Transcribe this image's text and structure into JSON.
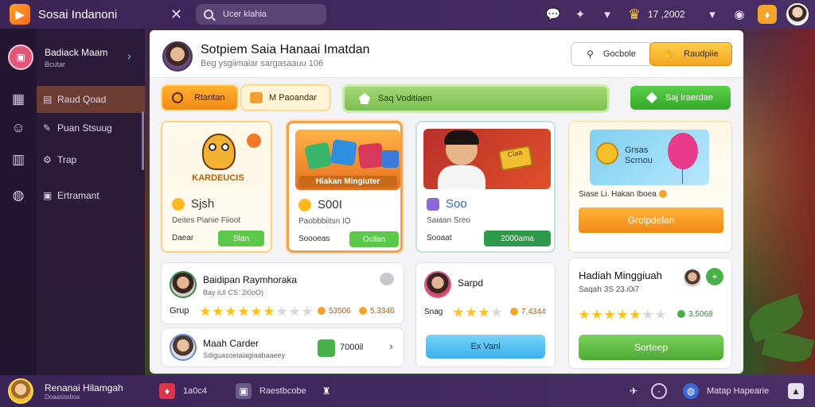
{
  "app": {
    "title": "Sosai Indanoni",
    "logo_glyph": "▶",
    "close_glyph": "✕"
  },
  "topbar": {
    "search_placeholder": "Ucer klahia",
    "coins": "17 ,2002",
    "icons": [
      "chat-icon",
      "gamepad-icon",
      "crown-icon",
      "chevron-down-icon",
      "controller-icon",
      "gift-icon",
      "avatar"
    ]
  },
  "sidebar": {
    "profile_name": "Badiack Maam",
    "profile_sub": "Bcutar",
    "items": [
      {
        "label": "Raud Qoad",
        "icon": "store-icon",
        "active": true
      },
      {
        "label": "Puan Stsuug",
        "icon": "people-icon",
        "active": false
      },
      {
        "label": "Trap",
        "icon": "trash-icon",
        "active": false
      },
      {
        "label": "Ertramant",
        "icon": "settings-icon",
        "active": false
      }
    ]
  },
  "panel": {
    "title": "Sotpiem Saia Hanaai Imatdan",
    "subtitle": "Beg ysgiimaiar sargasaauu 106",
    "btn_outline": "Gocbole",
    "btn_orange": "Raudpiie"
  },
  "filters": {
    "pill1": "Rtantan",
    "pill2": "M Paoandar",
    "search_bar": "Saq Voditiaen",
    "btn_green": "Saj Iraerdae"
  },
  "cards": [
    {
      "thumb_text": "KARDEUCIS",
      "title": "Sjsh",
      "desc": "Deites Pianie Fiioot",
      "meta": "Daear",
      "btn": "Slan",
      "btn_color": "#5cc94a"
    },
    {
      "thumb_text": "Hiakan Mingiuter",
      "title": "S00I",
      "desc": "Paobbbiitsn IO",
      "meta": "Soooeas",
      "btn": "Ocilan",
      "btn_color": "#5cc94a"
    },
    {
      "thumb_text": "Ciaa",
      "title": "Soo",
      "desc": "Saiaan Sreo",
      "meta": "Sooaat",
      "btn": "2000ama",
      "btn_color": "#2f9a4a"
    },
    {
      "thumb_text": "Grsas Scrnou",
      "title": "Siase Li. Hakan Iboea",
      "desc": "",
      "meta": "",
      "btn": "Grolpdelan",
      "btn_color": "#f59a1a"
    }
  ],
  "list_cards": {
    "row1": {
      "name": "Baidipan Raymhoraka",
      "sub": "Bay iUI CS: 2i0oO)",
      "label": "Grup",
      "num1": "53506",
      "num2": "5,3346",
      "stars_on": 6,
      "stars_total": 9
    },
    "row2": {
      "name": "Maah Carder",
      "sub": "Sdiguasoeiaiagiaabaaeey",
      "value": "7000il"
    },
    "mid": {
      "name": "Sarpd",
      "label": "Snag",
      "num": "7,4344",
      "stars_on": 3,
      "stars_total": 4,
      "btn": "Ex Vanl"
    },
    "right": {
      "name": "Hadiah Minggiuah",
      "sub": "Saqah 3S 23.i0i7",
      "num": "3,5068",
      "stars_on": 5,
      "stars_total": 7,
      "btn": "Sorteep"
    }
  },
  "bottombar": {
    "name": "Renanai Hilamgah",
    "sub": "Doaasisdioa",
    "item1": "1a0c4",
    "item2": "Raestbcobe",
    "item3": "Matap Hapearie",
    "icons": [
      "gift-icon",
      "camera-icon",
      "rook-icon",
      "megaphone-icon",
      "shield-icon",
      "globe-icon",
      "chevron-up-icon"
    ]
  }
}
